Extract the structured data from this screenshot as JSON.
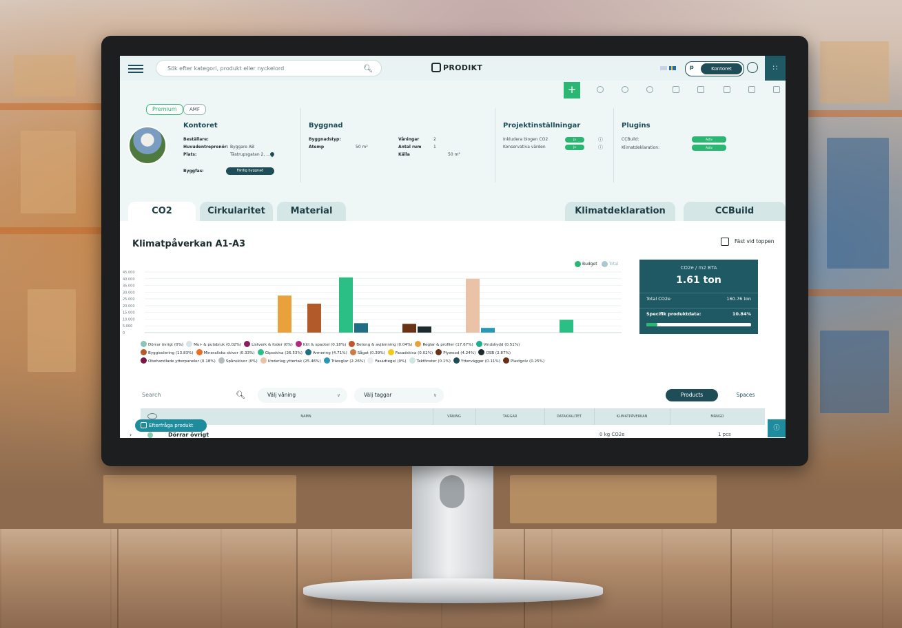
{
  "topbar": {
    "search_placeholder": "Sök efter kategori, produkt eller nyckelord",
    "logo_text": "PRODIKT",
    "user_initial": "p",
    "user_name": "Kontoret"
  },
  "project": {
    "badges": [
      "Premium",
      "AMF"
    ],
    "office": {
      "title": "Kontoret",
      "client_label": "Beställare:",
      "client_value": "",
      "contractor_label": "Huvudentreprenör:",
      "contractor_value": "Byggare AB",
      "place_label": "Plats:",
      "place_value": "Tästrupsgatan 2, ...",
      "phase_label": "Byggfas:",
      "phase_value": "Färdig byggnad"
    },
    "building": {
      "title": "Byggnad",
      "type_label": "Byggnadstyp:",
      "type_value": "",
      "atemp_label": "Atemp",
      "atemp_value": "50 m²",
      "floors_label": "Våningar",
      "floors_value": "2",
      "rooms_label": "Antal rum",
      "rooms_value": "1",
      "basement_label": "Källa",
      "basement_value": "50 m²"
    },
    "settings": {
      "title": "Projektinställningar",
      "items": [
        {
          "label": "Inkludera biogen CO2",
          "toggle": "Ja"
        },
        {
          "label": "Konservativa värden",
          "toggle": "Ja"
        }
      ]
    },
    "plugins": {
      "title": "Plugins",
      "items": [
        {
          "label": "CCBuild:",
          "toggle": "Aktiv"
        },
        {
          "label": "Klimatdeklaration:",
          "toggle": "Aktiv"
        }
      ]
    }
  },
  "tabs": [
    "CO2",
    "Cirkularitet",
    "Material",
    "Klimatdeklaration",
    "CCBuild"
  ],
  "section": {
    "title": "Klimatpåverkan A1-A3",
    "pin_label": "Fäst vid toppen"
  },
  "chart_data": {
    "type": "bar",
    "ylim": [
      0,
      45000
    ],
    "yticks": [
      "45.000",
      "40.000",
      "35.000",
      "30.000",
      "25.000",
      "20.000",
      "15.000",
      "10.000",
      "5.000",
      "0"
    ],
    "legend": [
      "Budget",
      "Total"
    ],
    "series": [
      {
        "name": "Budget",
        "values": [
          0,
          0,
          0,
          0,
          0,
          27000,
          0,
          0,
          0,
          0,
          0,
          0,
          0,
          0,
          0,
          0,
          0,
          0,
          0,
          0,
          0,
          0
        ]
      },
      {
        "name": "Total",
        "values": [
          0,
          0,
          0,
          0,
          0,
          0,
          0,
          0,
          0,
          0,
          0,
          0,
          0,
          0,
          0,
          0,
          0,
          0,
          0,
          0,
          0,
          0
        ]
      }
    ],
    "bars": [
      {
        "color": "#e9a23b",
        "value": 27500
      },
      {
        "color": "#b35a2a",
        "value": 21500
      },
      {
        "color": "#2bbf86",
        "value": 41000
      },
      {
        "color": "#1f6e84",
        "value": 7000
      },
      {
        "color": "#6a3315",
        "value": 6500
      },
      {
        "color": "#1d2b2e",
        "value": 4500
      },
      {
        "color": "#e9c2a8",
        "value": 40000
      },
      {
        "color": "#2a97b4",
        "value": 3500
      },
      {
        "color": "#2bbf86",
        "value": 9500
      }
    ],
    "categories": [
      {
        "label": "Dörrar övrigt (0%)",
        "color": "#8bc6b5"
      },
      {
        "label": "Mur- & putsbruk (0.02%)",
        "color": "#d8e4e4"
      },
      {
        "label": "Listverk & foder (0%)",
        "color": "#8a1d5c"
      },
      {
        "label": "Kitt & spackel (0.18%)",
        "color": "#b3287a"
      },
      {
        "label": "Betong & avjämning (0.04%)",
        "color": "#c4552a"
      },
      {
        "label": "Reglar & profiler (17.67%)",
        "color": "#e9a23b"
      },
      {
        "label": "Vindskydd (0.51%)",
        "color": "#1fae8c"
      },
      {
        "label": "Byggisolering (13.83%)",
        "color": "#b35a2a"
      },
      {
        "label": "Mineraliska skivor (0.33%)",
        "color": "#f06a1f"
      },
      {
        "label": "Gipsskiva (26.53%)",
        "color": "#2bbf86"
      },
      {
        "label": "Armering (4.71%)",
        "color": "#1f6e84"
      },
      {
        "label": "Sågat (0.39%)",
        "color": "#c97b4a"
      },
      {
        "label": "Fasadskiva (0.02%)",
        "color": "#f4c81a"
      },
      {
        "label": "Plywood (4.24%)",
        "color": "#6a3315"
      },
      {
        "label": "OSB (2.87%)",
        "color": "#1d2b2e"
      },
      {
        "label": "Obehandlade ytterpaneler (0.18%)",
        "color": "#7a1842"
      },
      {
        "label": "Spånskivor (0%)",
        "color": "#b5bcbd"
      },
      {
        "label": "Underlag yttertak (25.46%)",
        "color": "#e9c2a8"
      },
      {
        "label": "Träreglar (2.26%)",
        "color": "#2a97b4"
      },
      {
        "label": "Fasadtegel (0%)",
        "color": "#e9eded"
      },
      {
        "label": "Takfönster (0.1%)",
        "color": "#cfe7e0"
      },
      {
        "label": "Ytterväggar (0.11%)",
        "color": "#1f4d57"
      },
      {
        "label": "Plastgolv (0.25%)",
        "color": "#6a2f12"
      }
    ]
  },
  "co2_card": {
    "title": "CO2e / m2 BTA",
    "value": "1.61 ton",
    "total_label": "Total CO2e",
    "total_value": "160.76 ton",
    "specific_label": "Specifik produktdata:",
    "specific_value": "10.84%",
    "specific_fraction": 0.1084
  },
  "filters": {
    "search_placeholder": "Search",
    "floor_select": "Välj våning",
    "tag_select": "Välj taggar",
    "products_label": "Products",
    "spaces_label": "Spaces"
  },
  "table": {
    "headers": [
      "NAMN",
      "VÅNING",
      "TAGGAR",
      "DATAKVALITET",
      "KLIMATPÅVERKAN",
      "MÄNGD"
    ],
    "rows": [
      {
        "name": "Dörrar övrigt",
        "climate": "0 kg CO2e",
        "qty": "1 pcs"
      }
    ]
  },
  "request_button": "Efterfråga produkt",
  "colors": {
    "accent": "#2bb673",
    "primary": "#1f4d57",
    "teal": "#1f8c9e"
  }
}
